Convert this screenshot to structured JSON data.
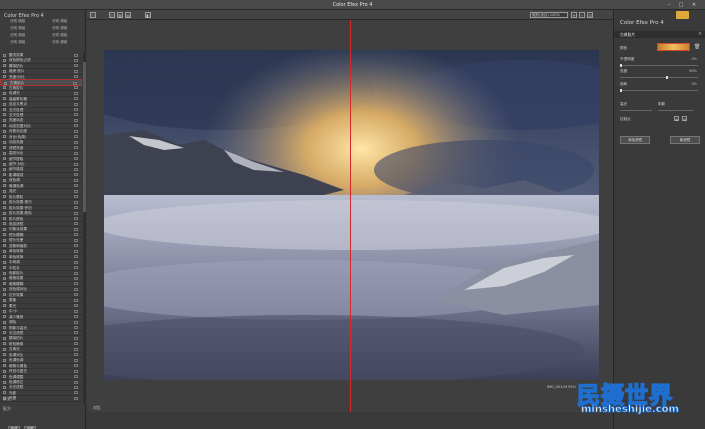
{
  "window": {
    "title": "Color Efex Pro 4"
  },
  "left_panel": {
    "app_title": "Color Efex Pro 4",
    "favorites": [
      [
        "分别 调组",
        "分别 调组"
      ],
      [
        "分别 调组",
        "分别 调组"
      ],
      [
        "分别 调组",
        "分别 调组"
      ],
      [
        "分别 调组",
        "分别 调组"
      ]
    ],
    "filters": [
      "酸洗效果",
      "双色颜色过滤",
      "模拟拍片",
      "暗房·底片",
      "亮度/对比",
      "古典胶片",
      "古典胶片",
      "色调光",
      "高级雾化器",
      "自定义黑点",
      "交叉处理",
      "交叉处理",
      "亮度动态",
      "动态范围对比",
      "对数对比度",
      "对比(色调)",
      "动态亮度",
      "滤镜亮度",
      "高亮对比",
      "细节提取",
      "细节·对比",
      "细节增强",
      "影调增强",
      "双色调",
      "暗调色调",
      "强光",
      "胶片颗粒",
      "胶片效果·现代",
      "胶片效果·怀旧",
      "胶片效果·颜色",
      "胶片颜色",
      "渐变滤镜",
      "印象派效果",
      "镜头模糊",
      "镜头光晕",
      "变焦和裁剪",
      "单色转换",
      "单色转换",
      "中间调",
      "中性灰",
      "电影胶片",
      "暗角效果",
      "暗角模糊",
      "双色调对比",
      "红外效果",
      "柔焦",
      "柔光",
      "中·小",
      "减少噪音",
      "调色",
      "阴影与高光",
      "天空滤镜",
      "模拟拍片",
      "斑驳暗角",
      "古典光",
      "色调对比",
      "色调色调",
      "暗角与褪色",
      "怀旧与复古",
      "色调调整",
      "色调修正",
      "天光滤镜",
      "光影",
      "光晕"
    ],
    "selected_filter_index": 5,
    "history_label": "历史",
    "recipes_label": "配方",
    "buttons": [
      "新建",
      "设置"
    ]
  },
  "toolbar": {
    "zoom_select": "缩放(适合) 100%"
  },
  "canvas": {
    "compare_label": "对比",
    "file_info": "IMG_001.tif  55%"
  },
  "right_panel": {
    "title": "Color Efex Pro 4",
    "section_title": "古典胶片",
    "params": {
      "color_label": "颜色",
      "strength_label": "不透明度",
      "strength_value": "0%",
      "brightness_label": "亮度",
      "brightness_value": "60%",
      "saturation_label": "饱和",
      "saturation_value": "0%",
      "highlights_label": "高光",
      "shadows_label": "阴影",
      "control_points_label": "控制点",
      "add_filter_button": "添加滤镜",
      "new_filter_button": "新滤镜"
    },
    "slider_levels": {
      "strength": 0.0,
      "brightness": 0.6,
      "saturation": 0.0
    }
  },
  "watermark": {
    "title": "民摄世界",
    "url": "minsheshijie.com"
  },
  "colors": {
    "split_line": "#d42a2a",
    "swatch_border": "#d04a2a",
    "brand_blue": "#1e6fd0"
  }
}
